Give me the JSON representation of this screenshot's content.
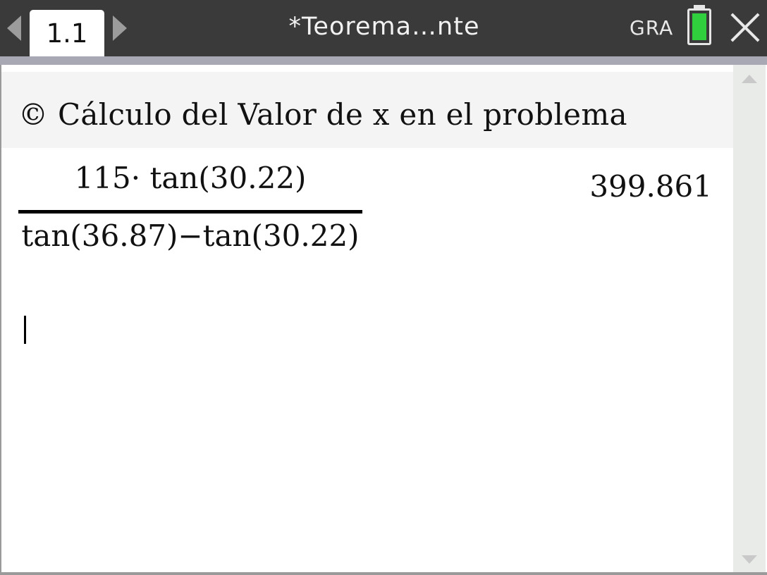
{
  "titlebar": {
    "tab_label": "1.1",
    "document_title": "*Teorema…nte",
    "mode": "GRA",
    "battery_color": "#2fcf3e"
  },
  "icons": {
    "prev_page": "left-arrow-icon",
    "next_page": "right-arrow-icon",
    "battery": "battery-icon",
    "close": "close-icon",
    "scroll_up": "scroll-up-icon",
    "scroll_down": "scroll-down-icon"
  },
  "calculator": {
    "comment": "© Cálculo del Valor de x en el problema",
    "entry": {
      "numerator": "115· tan(30.22)",
      "denominator": "tan(36.87)−tan(30.22)",
      "result": "399.861"
    }
  },
  "colors": {
    "titlebar_bg": "#3a3a3a",
    "accent_bar": "#a7a8b3",
    "comment_bg": "#f4f4f4",
    "scrollbar_bg": "#e9ebe9"
  }
}
